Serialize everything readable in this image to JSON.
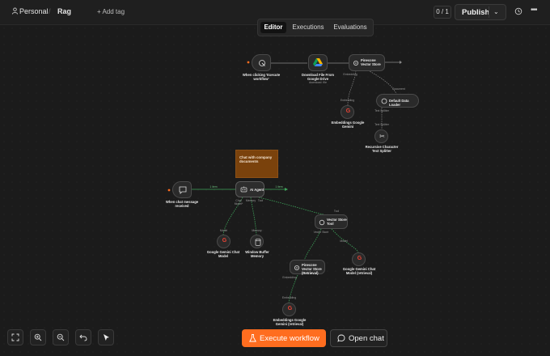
{
  "header": {
    "project": "Personal",
    "workflow_name": "Rag",
    "add_tag": "+ Add tag",
    "counter": "0 / 1",
    "publish_label": "Publish"
  },
  "tabs": [
    {
      "label": "Editor",
      "active": true
    },
    {
      "label": "Executions",
      "active": false
    },
    {
      "label": "Evaluations",
      "active": false
    }
  ],
  "nodes": {
    "trigger_exec": {
      "label": "When clicking 'Execute workflow'"
    },
    "drive": {
      "label": "Download File From Google Drive",
      "sub": "download: file"
    },
    "pinecone_store": {
      "label": "Pinecone Vector Store"
    },
    "embeddings_top": {
      "label": "Embeddings Google Gemini"
    },
    "loader": {
      "label": "Default Data Loader"
    },
    "splitter": {
      "label": "Recursive Character Text Splitter"
    },
    "sticky": {
      "label": "Chat with company documents"
    },
    "chat_trigger": {
      "label": "When chat message received"
    },
    "agent": {
      "label": "AI Agent"
    },
    "gemini_chat": {
      "label": "Google Gemini Chat Model"
    },
    "memory": {
      "label": "Window Buffer Memory"
    },
    "vector_tool": {
      "label": "Vector Store Tool"
    },
    "pinecone_retrieval": {
      "label": "Pinecone Vector Store (Retrieval)"
    },
    "gemini_chat_retrieval": {
      "label": "Google Gemini Chat Model (retrieval)"
    },
    "embeddings_retrieval": {
      "label": "Embeddings Google Gemini (retrieval)"
    }
  },
  "ports": {
    "embedding": "Embedding",
    "document": "Document",
    "text_splitter": "Text Splitter",
    "chat_model": "Chat Model*",
    "memory": "Memory",
    "tool": "Tool",
    "model": "Model",
    "vector_store": "Vector Store",
    "chat_model_req": "Chat Model*",
    "memory_req": "Memory",
    "tool_label": "Tool",
    "vector_store_port": "Vector Store",
    "model_port": "Model",
    "embedding_port": "Embedding",
    "main_in": "Main",
    "embedding_top": "Embedding",
    "document_top": "Document",
    "text_splitter_top": "Text Splitter"
  },
  "edges": {
    "item1": "1 item",
    "item2": "1 item"
  },
  "footer": {
    "execute_label": "Execute workflow",
    "chat_label": "Open chat"
  },
  "colors": {
    "accent": "#ff6d1f",
    "edge_green": "#3ea35a",
    "sticky": "#7a420c"
  }
}
